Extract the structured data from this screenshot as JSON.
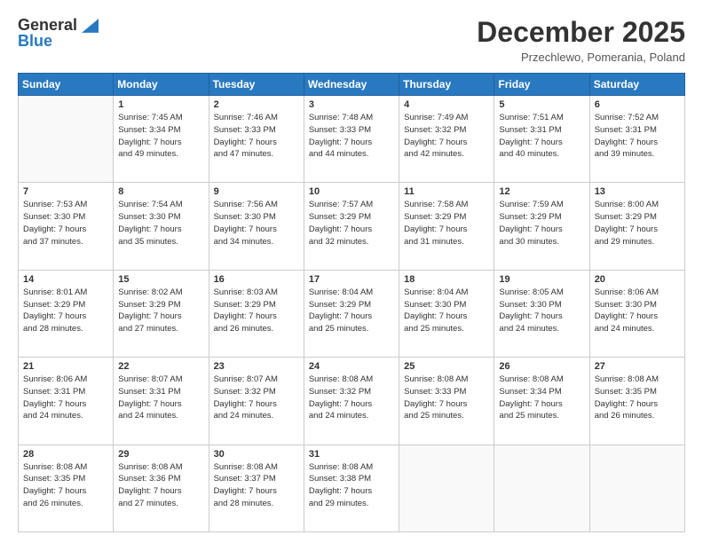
{
  "header": {
    "logo_line1": "General",
    "logo_line2": "Blue",
    "month_title": "December 2025",
    "subtitle": "Przechlewo, Pomerania, Poland"
  },
  "days_of_week": [
    "Sunday",
    "Monday",
    "Tuesday",
    "Wednesday",
    "Thursday",
    "Friday",
    "Saturday"
  ],
  "weeks": [
    [
      {
        "day": "",
        "info": ""
      },
      {
        "day": "1",
        "info": "Sunrise: 7:45 AM\nSunset: 3:34 PM\nDaylight: 7 hours\nand 49 minutes."
      },
      {
        "day": "2",
        "info": "Sunrise: 7:46 AM\nSunset: 3:33 PM\nDaylight: 7 hours\nand 47 minutes."
      },
      {
        "day": "3",
        "info": "Sunrise: 7:48 AM\nSunset: 3:33 PM\nDaylight: 7 hours\nand 44 minutes."
      },
      {
        "day": "4",
        "info": "Sunrise: 7:49 AM\nSunset: 3:32 PM\nDaylight: 7 hours\nand 42 minutes."
      },
      {
        "day": "5",
        "info": "Sunrise: 7:51 AM\nSunset: 3:31 PM\nDaylight: 7 hours\nand 40 minutes."
      },
      {
        "day": "6",
        "info": "Sunrise: 7:52 AM\nSunset: 3:31 PM\nDaylight: 7 hours\nand 39 minutes."
      }
    ],
    [
      {
        "day": "7",
        "info": "Sunrise: 7:53 AM\nSunset: 3:30 PM\nDaylight: 7 hours\nand 37 minutes."
      },
      {
        "day": "8",
        "info": "Sunrise: 7:54 AM\nSunset: 3:30 PM\nDaylight: 7 hours\nand 35 minutes."
      },
      {
        "day": "9",
        "info": "Sunrise: 7:56 AM\nSunset: 3:30 PM\nDaylight: 7 hours\nand 34 minutes."
      },
      {
        "day": "10",
        "info": "Sunrise: 7:57 AM\nSunset: 3:29 PM\nDaylight: 7 hours\nand 32 minutes."
      },
      {
        "day": "11",
        "info": "Sunrise: 7:58 AM\nSunset: 3:29 PM\nDaylight: 7 hours\nand 31 minutes."
      },
      {
        "day": "12",
        "info": "Sunrise: 7:59 AM\nSunset: 3:29 PM\nDaylight: 7 hours\nand 30 minutes."
      },
      {
        "day": "13",
        "info": "Sunrise: 8:00 AM\nSunset: 3:29 PM\nDaylight: 7 hours\nand 29 minutes."
      }
    ],
    [
      {
        "day": "14",
        "info": "Sunrise: 8:01 AM\nSunset: 3:29 PM\nDaylight: 7 hours\nand 28 minutes."
      },
      {
        "day": "15",
        "info": "Sunrise: 8:02 AM\nSunset: 3:29 PM\nDaylight: 7 hours\nand 27 minutes."
      },
      {
        "day": "16",
        "info": "Sunrise: 8:03 AM\nSunset: 3:29 PM\nDaylight: 7 hours\nand 26 minutes."
      },
      {
        "day": "17",
        "info": "Sunrise: 8:04 AM\nSunset: 3:29 PM\nDaylight: 7 hours\nand 25 minutes."
      },
      {
        "day": "18",
        "info": "Sunrise: 8:04 AM\nSunset: 3:30 PM\nDaylight: 7 hours\nand 25 minutes."
      },
      {
        "day": "19",
        "info": "Sunrise: 8:05 AM\nSunset: 3:30 PM\nDaylight: 7 hours\nand 24 minutes."
      },
      {
        "day": "20",
        "info": "Sunrise: 8:06 AM\nSunset: 3:30 PM\nDaylight: 7 hours\nand 24 minutes."
      }
    ],
    [
      {
        "day": "21",
        "info": "Sunrise: 8:06 AM\nSunset: 3:31 PM\nDaylight: 7 hours\nand 24 minutes."
      },
      {
        "day": "22",
        "info": "Sunrise: 8:07 AM\nSunset: 3:31 PM\nDaylight: 7 hours\nand 24 minutes."
      },
      {
        "day": "23",
        "info": "Sunrise: 8:07 AM\nSunset: 3:32 PM\nDaylight: 7 hours\nand 24 minutes."
      },
      {
        "day": "24",
        "info": "Sunrise: 8:08 AM\nSunset: 3:32 PM\nDaylight: 7 hours\nand 24 minutes."
      },
      {
        "day": "25",
        "info": "Sunrise: 8:08 AM\nSunset: 3:33 PM\nDaylight: 7 hours\nand 25 minutes."
      },
      {
        "day": "26",
        "info": "Sunrise: 8:08 AM\nSunset: 3:34 PM\nDaylight: 7 hours\nand 25 minutes."
      },
      {
        "day": "27",
        "info": "Sunrise: 8:08 AM\nSunset: 3:35 PM\nDaylight: 7 hours\nand 26 minutes."
      }
    ],
    [
      {
        "day": "28",
        "info": "Sunrise: 8:08 AM\nSunset: 3:35 PM\nDaylight: 7 hours\nand 26 minutes."
      },
      {
        "day": "29",
        "info": "Sunrise: 8:08 AM\nSunset: 3:36 PM\nDaylight: 7 hours\nand 27 minutes."
      },
      {
        "day": "30",
        "info": "Sunrise: 8:08 AM\nSunset: 3:37 PM\nDaylight: 7 hours\nand 28 minutes."
      },
      {
        "day": "31",
        "info": "Sunrise: 8:08 AM\nSunset: 3:38 PM\nDaylight: 7 hours\nand 29 minutes."
      },
      {
        "day": "",
        "info": ""
      },
      {
        "day": "",
        "info": ""
      },
      {
        "day": "",
        "info": ""
      }
    ]
  ]
}
